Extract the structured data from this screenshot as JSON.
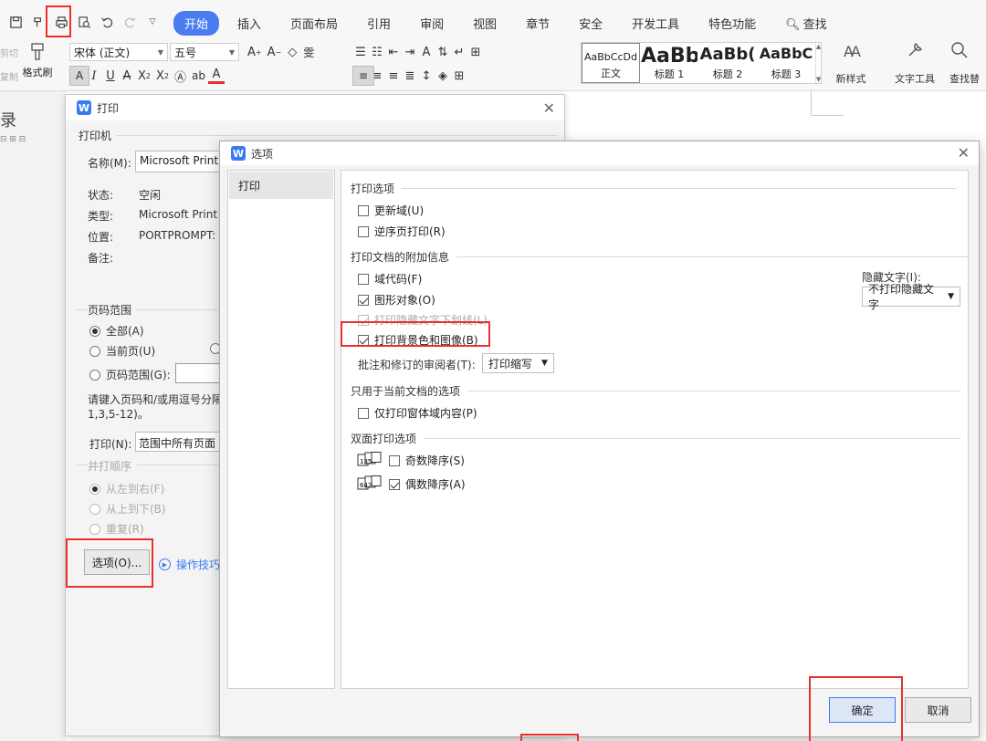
{
  "ribbon": {
    "tabs": [
      {
        "label": "开始",
        "active": true
      },
      {
        "label": "插入"
      },
      {
        "label": "页面布局"
      },
      {
        "label": "引用"
      },
      {
        "label": "审阅"
      },
      {
        "label": "视图"
      },
      {
        "label": "章节"
      },
      {
        "label": "安全"
      },
      {
        "label": "开发工具"
      },
      {
        "label": "特色功能"
      }
    ],
    "search_label": "查找",
    "cut_label": "剪切",
    "copy_label": "复制",
    "format_painter": "格式刷",
    "font": "宋体 (正文)",
    "size": "五号",
    "styles": [
      {
        "sample": "AaBbCcDd",
        "name": "正文"
      },
      {
        "sample": "AaBb",
        "name": "标题 1"
      },
      {
        "sample": "AaBb(",
        "name": "标题 2"
      },
      {
        "sample": "AaBbC",
        "name": "标题 3"
      }
    ],
    "new_style": "新样式",
    "text_tools": "文字工具",
    "find_replace": "查找替"
  },
  "doc": {
    "glyph": "录"
  },
  "print_dialog": {
    "title": "打印",
    "printer_group": "打印机",
    "name_label": "名称(M):",
    "name_value": "Microsoft Print",
    "status_label": "状态:",
    "status_value": "空闲",
    "type_label": "类型:",
    "type_value": "Microsoft Print",
    "location_label": "位置:",
    "location_value": "PORTPROMPT:",
    "comment_label": "备注:",
    "range_group": "页码范围",
    "range_all": "全部(A)",
    "range_current": "当前页(U)",
    "range_pages": "页码范围(G):",
    "range_hint_1": "请键入页码和/或用逗号分隔",
    "range_hint_2": "1,3,5-12)。",
    "print_label": "打印(N):",
    "print_value": "范围中所有页面",
    "collate_group": "并打顺序",
    "collate_lr": "从左到右(F)",
    "collate_tb": "从上到下(B)",
    "collate_repeat": "重复(R)",
    "options_button": "选项(O)...",
    "tips_link": "操作技巧"
  },
  "options_dialog": {
    "title": "选项",
    "category": "打印",
    "sec_print_options": "打印选项",
    "update_fields": "更新域(U)",
    "reverse_print": "逆序页打印(R)",
    "sec_extra_info": "打印文档的附加信息",
    "field_codes": "域代码(F)",
    "drawing_objects": "图形对象(O)",
    "hidden_underline": "打印隐藏文字下划线(L)",
    "background": "打印背景色和图像(B)",
    "reviewer_label": "批注和修订的审阅者(T):",
    "reviewer_value": "打印缩写",
    "hidden_text_label": "隐藏文字(I):",
    "hidden_text_value": "不打印隐藏文字",
    "sec_current_doc": "只用于当前文档的选项",
    "form_data_only": "仅打印窗体域内容(P)",
    "sec_duplex": "双面打印选项",
    "odd_desc": "奇数降序(S)",
    "even_desc": "偶数降序(A)",
    "dup_icon_odd": "135",
    "dup_icon_even": "642",
    "ok": "确定",
    "cancel": "取消"
  },
  "colors": {
    "accent": "#4a7cf0",
    "annotation": "#e8312f"
  }
}
